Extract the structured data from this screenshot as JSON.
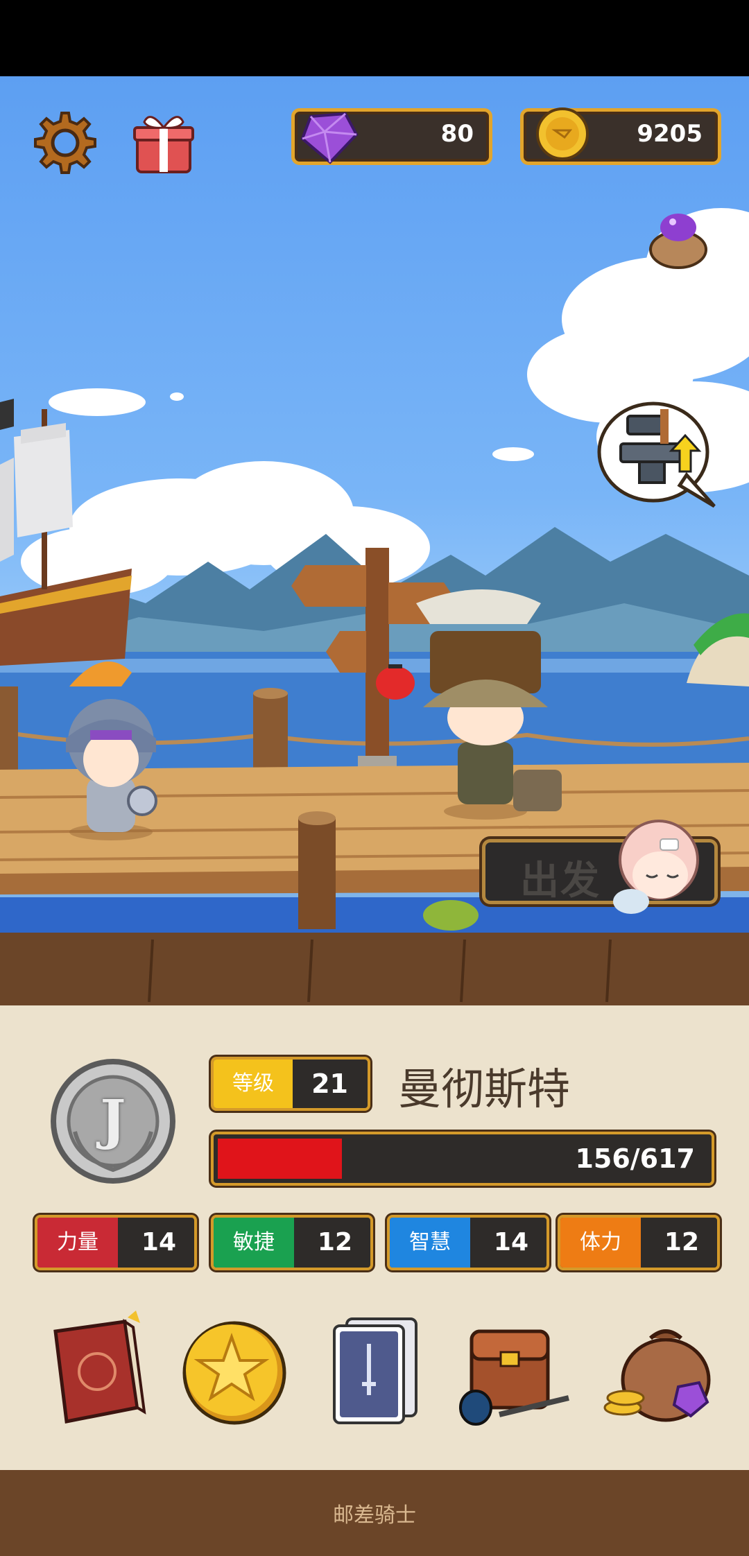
{
  "hud": {
    "gems": "80",
    "coins": "9205"
  },
  "scene": {
    "depart_button": "出发"
  },
  "hero": {
    "emblem_letter": "J",
    "level_label": "等级",
    "level_value": "21",
    "name": "曼彻斯特",
    "hp_text": "156/617",
    "hp_fraction": 0.253
  },
  "stats": [
    {
      "label": "力量",
      "value": "14",
      "color": "#c92a35"
    },
    {
      "label": "敏捷",
      "value": "12",
      "color": "#1aa150"
    },
    {
      "label": "智慧",
      "value": "14",
      "color": "#1f86e0"
    },
    {
      "label": "体力",
      "value": "12",
      "color": "#ee7c14"
    }
  ],
  "nav_icons": [
    "hero-book-icon",
    "star-coin-icon",
    "card-deck-icon",
    "inventory-bag-icon",
    "treasure-sack-icon"
  ],
  "footer": {
    "app_name": "邮差骑士"
  },
  "colors": {
    "accent_gold": "#e2a52c",
    "hp_red": "#e0141a",
    "panel_bg": "#ece2cd"
  }
}
